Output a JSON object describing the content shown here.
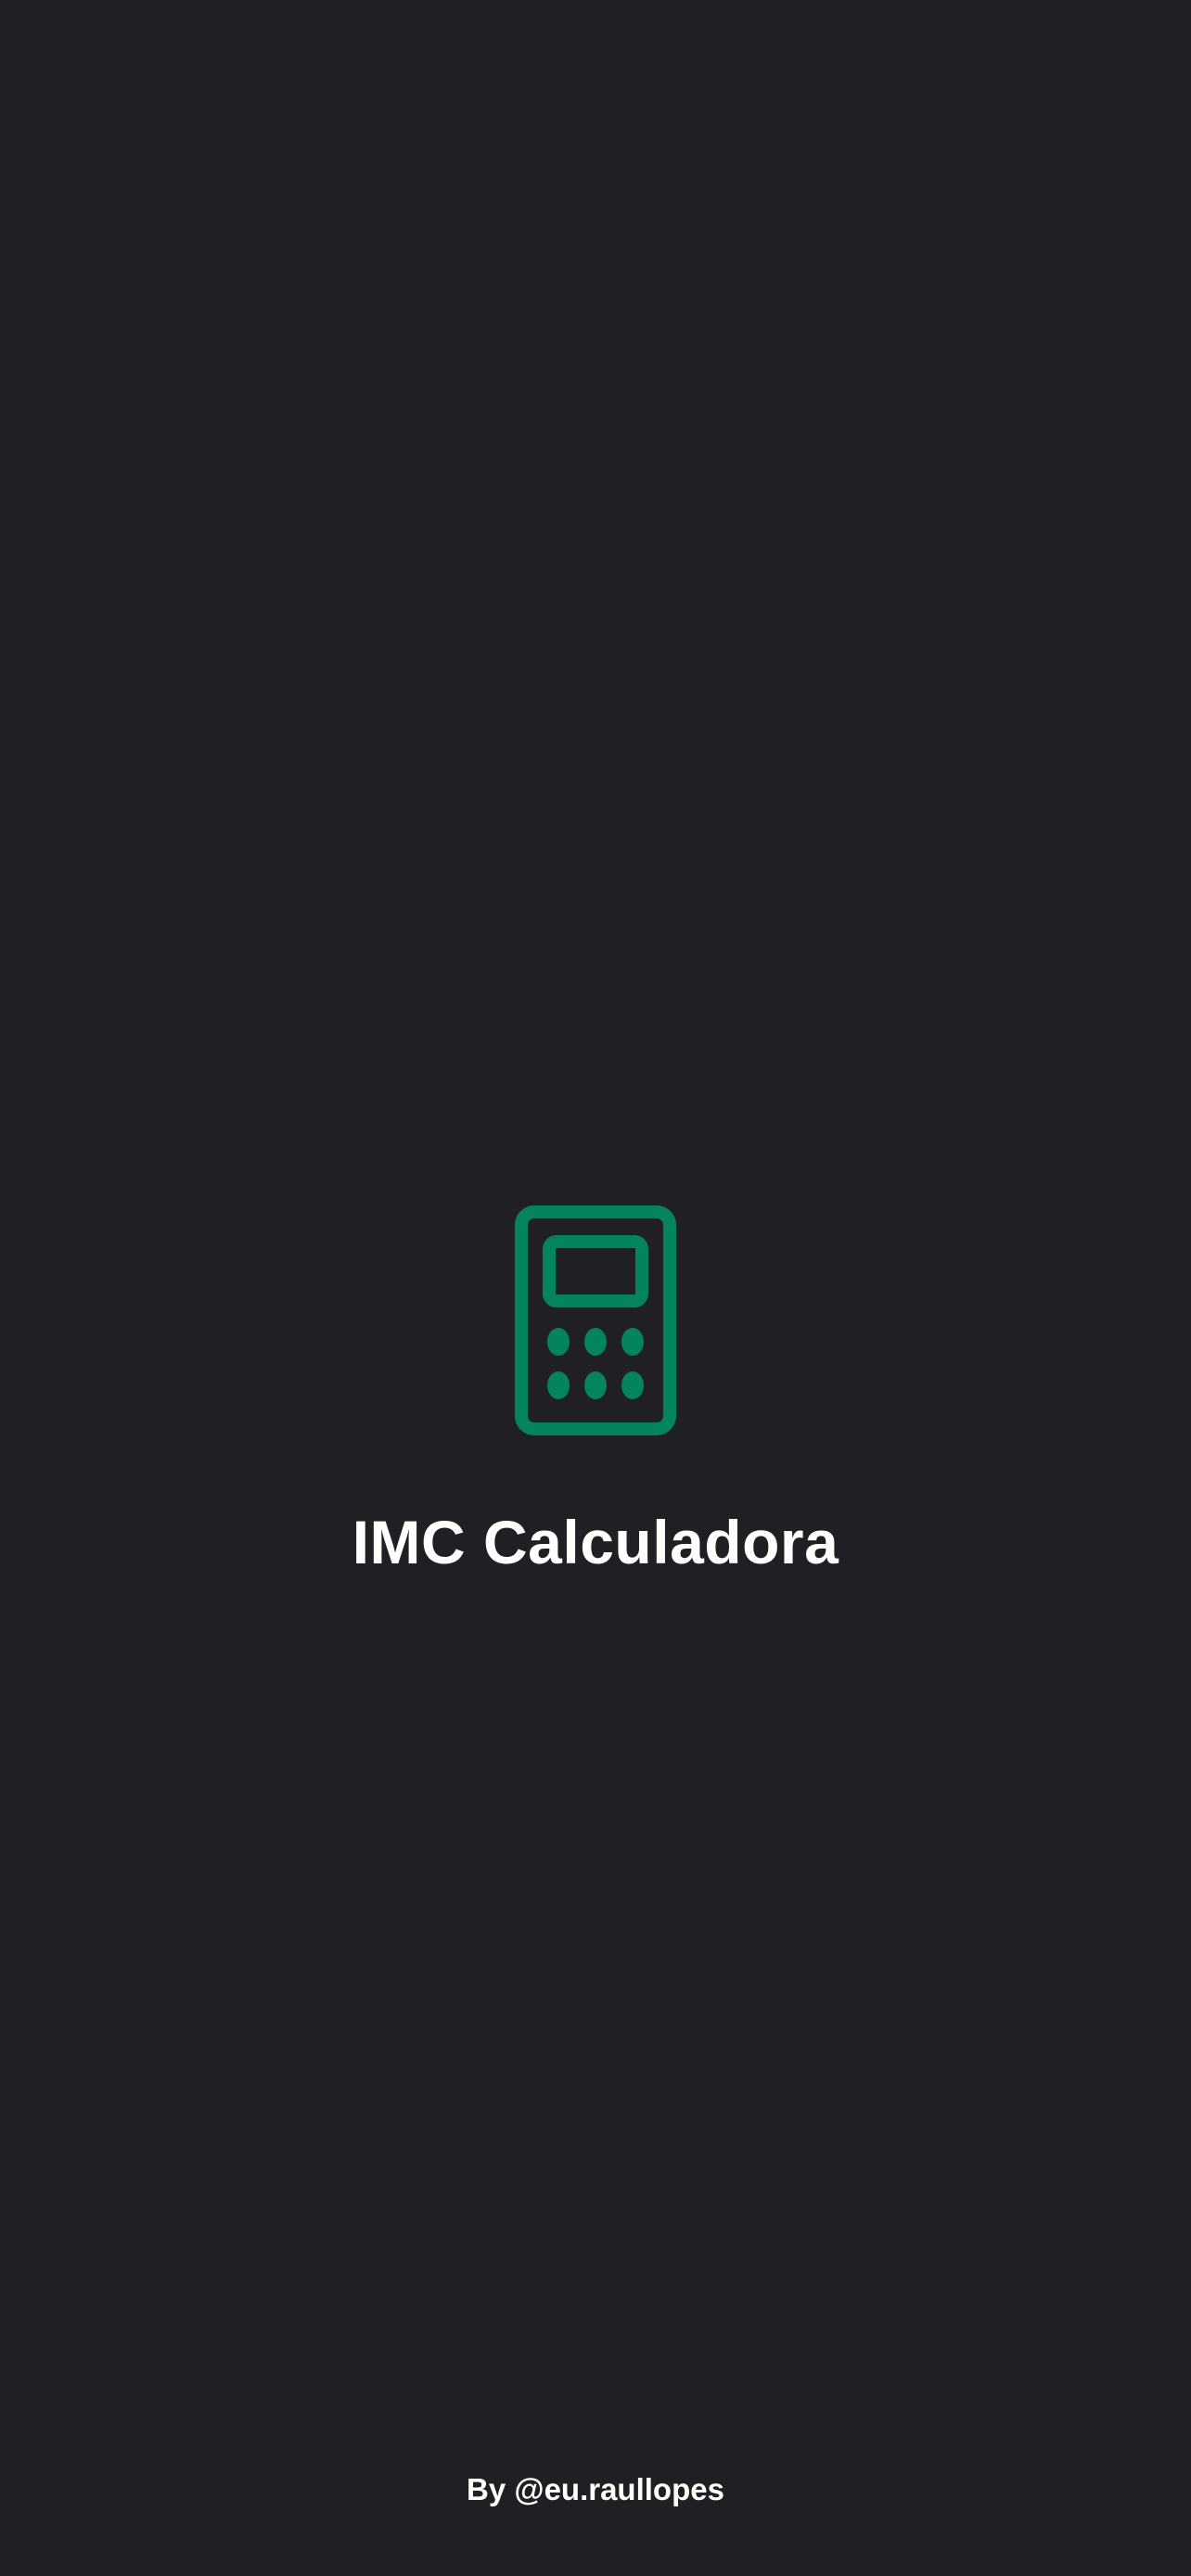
{
  "splash": {
    "logo_icon": "calculator-icon",
    "title": "IMC Calculadora",
    "credits": "By @eu.raullopes"
  },
  "colors": {
    "background": "#202024",
    "accent": "#04845C",
    "text": "#FFFFFF"
  }
}
